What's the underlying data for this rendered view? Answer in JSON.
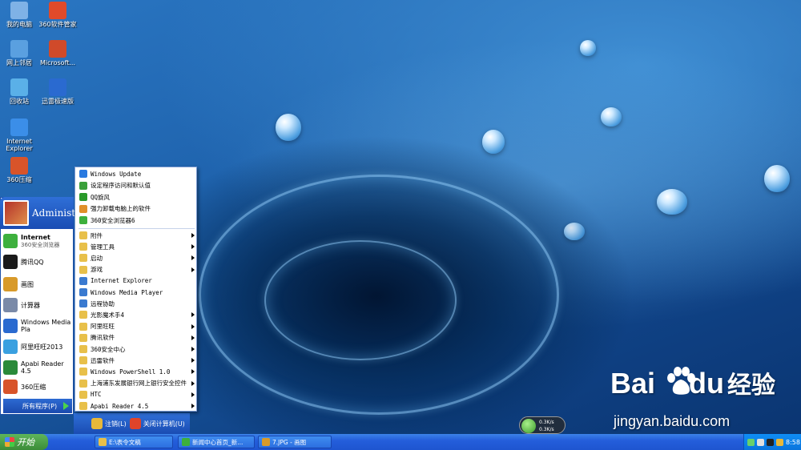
{
  "desktop": {
    "icons": [
      {
        "label": "我的电脑",
        "icon": "computer-icon",
        "color": "#7fb2e6"
      },
      {
        "label": "360软件管家",
        "icon": "software-manager-icon",
        "color": "#e04a2a"
      },
      {
        "label": "网上邻居",
        "icon": "network-icon",
        "color": "#5aa0e0"
      },
      {
        "label": "Microsoft...",
        "icon": "office-icon",
        "color": "#d04a2a"
      },
      {
        "label": "回收站",
        "icon": "recycle-bin-icon",
        "color": "#5ab0e8"
      },
      {
        "label": "迅雷极速版",
        "icon": "thunder-icon",
        "color": "#2a6ad0"
      },
      {
        "label": "Internet Explorer",
        "icon": "ie-icon",
        "color": "#3b8ee8"
      },
      {
        "label": "360压缩",
        "icon": "archive-icon",
        "color": "#d8542a"
      }
    ]
  },
  "start_menu": {
    "user": "Administrator",
    "pinned": [
      {
        "label": "Internet",
        "sub": "360安全浏览器",
        "icon": "browser-icon",
        "color": "#3db03d"
      },
      {
        "label": "腾讯QQ",
        "icon": "qq-icon",
        "color": "#1a1a1a"
      },
      {
        "label": "画图",
        "icon": "paint-icon",
        "color": "#d89a2a"
      },
      {
        "label": "计算器",
        "icon": "calculator-icon",
        "color": "#7a8aa8"
      },
      {
        "label": "Windows Media Pla",
        "icon": "media-player-icon",
        "color": "#2a6ad0"
      },
      {
        "label": "阿里旺旺2013",
        "icon": "aliwangwang-icon",
        "color": "#3aa0e0"
      },
      {
        "label": "Apabi Reader 4.5",
        "icon": "apabi-icon",
        "color": "#2a8a3a"
      },
      {
        "label": "360压缩",
        "icon": "archive-icon",
        "color": "#d8542a"
      }
    ],
    "all_programs": "所有程序(P)",
    "logoff": "注销(L)",
    "shutdown": "关闭计算机(U)"
  },
  "programs_menu": {
    "top": [
      {
        "label": "Windows Update",
        "icon": "windows-update-icon",
        "color": "#2a7ae0"
      },
      {
        "label": "设定程序访问和默认值",
        "icon": "default-programs-icon",
        "color": "#3aa03a"
      },
      {
        "label": "QQ旋风",
        "icon": "qq-whirlwind-icon",
        "color": "#2a9a2a"
      },
      {
        "label": "强力卸载电脑上的软件",
        "icon": "uninstall-icon",
        "color": "#e0902a"
      },
      {
        "label": "360安全浏览器6",
        "icon": "browser-icon",
        "color": "#3db03d"
      }
    ],
    "items": [
      {
        "label": "附件",
        "icon": "folder-icon",
        "submenu": true
      },
      {
        "label": "管理工具",
        "icon": "folder-icon",
        "submenu": true
      },
      {
        "label": "启动",
        "icon": "folder-icon",
        "submenu": true
      },
      {
        "label": "游戏",
        "icon": "folder-icon",
        "submenu": true
      },
      {
        "label": "Internet Explorer",
        "icon": "ie-icon",
        "submenu": false
      },
      {
        "label": "Windows Media Player",
        "icon": "media-player-icon",
        "submenu": false
      },
      {
        "label": "远程协助",
        "icon": "remote-assist-icon",
        "submenu": false
      },
      {
        "label": "光影魔术手4",
        "icon": "folder-icon",
        "submenu": true
      },
      {
        "label": "阿里旺旺",
        "icon": "folder-icon",
        "submenu": true
      },
      {
        "label": "腾讯软件",
        "icon": "folder-icon",
        "submenu": true
      },
      {
        "label": "360安全中心",
        "icon": "folder-icon",
        "submenu": true
      },
      {
        "label": "迅雷软件",
        "icon": "folder-icon",
        "submenu": true
      },
      {
        "label": "Windows PowerShell 1.0",
        "icon": "folder-icon",
        "submenu": true
      },
      {
        "label": "上海浦东发展银行网上银行安全控件",
        "icon": "folder-icon",
        "submenu": true
      },
      {
        "label": "HTC",
        "icon": "folder-icon",
        "submenu": true
      },
      {
        "label": "Apabi Reader 4.5",
        "icon": "folder-icon",
        "submenu": true
      }
    ]
  },
  "taskbar": {
    "start": "开始",
    "tasks": [
      {
        "label": "E:\\表令文稿",
        "icon": "folder-icon"
      },
      {
        "label": "新闻中心首页_新...",
        "icon": "browser-icon"
      },
      {
        "label": "7.JPG - 画图",
        "icon": "paint-icon"
      }
    ],
    "clock": "8:58"
  },
  "net_speed": {
    "up": "0.3K/s",
    "down": "0.3K/s",
    "percent": "56%"
  },
  "watermark": {
    "brand": "Bai",
    "brand2": "du",
    "brand_cn": "经验",
    "url": "jingyan.baidu.com"
  },
  "colors": {
    "taskbar": "#245edb",
    "start": "#3b8c38",
    "menu_header": "#1a4cb3",
    "folder": "#e8c04a"
  }
}
